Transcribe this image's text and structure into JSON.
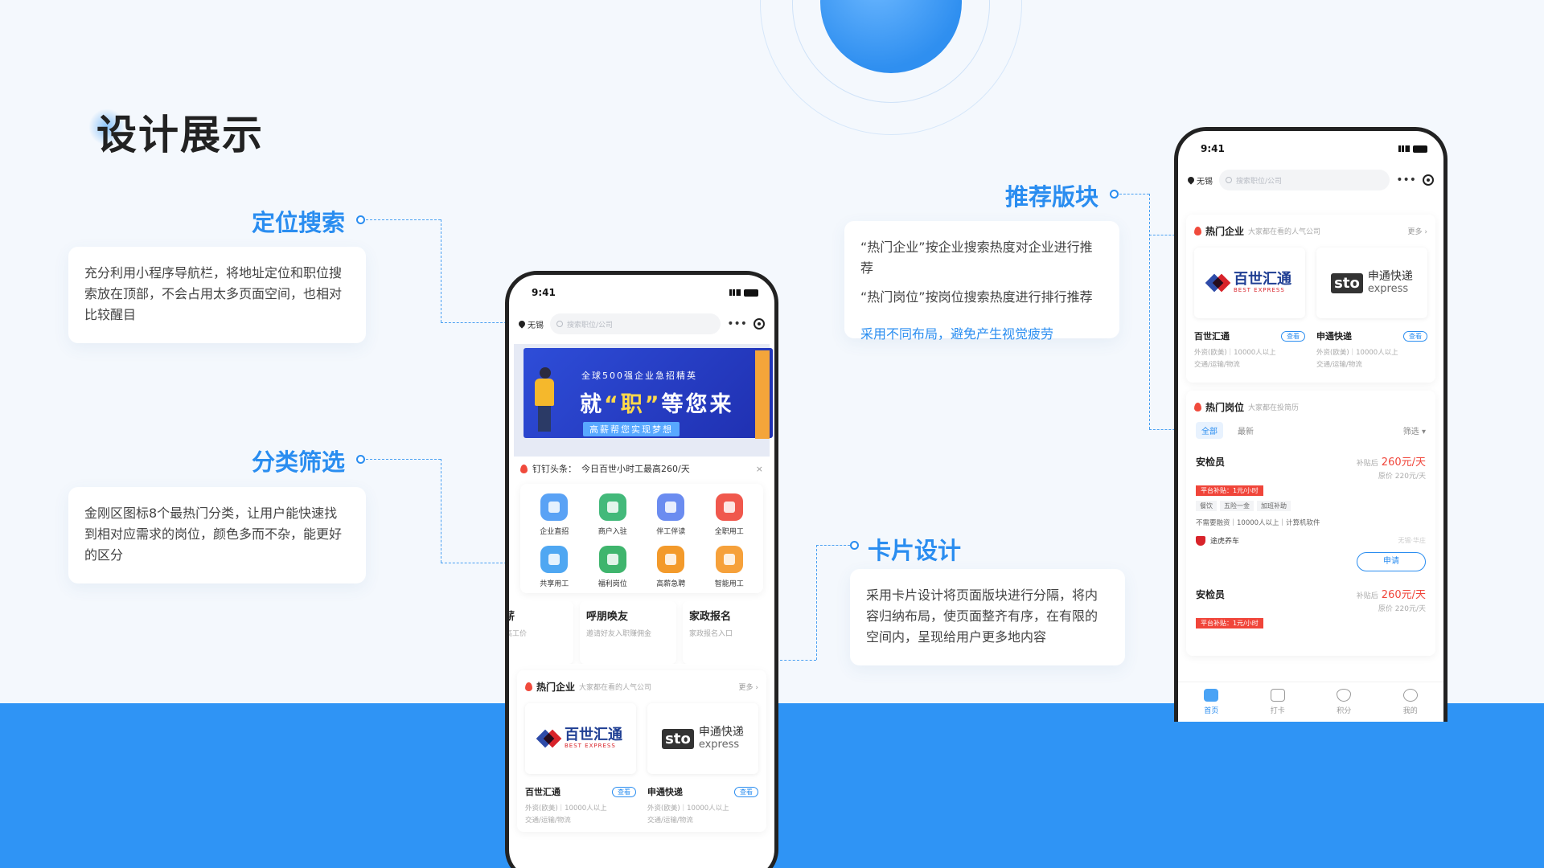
{
  "page": {
    "title": "设计展示"
  },
  "accent_color": "#2a8df0",
  "band_color": "#2f94f5",
  "annotations": {
    "location_search": {
      "label": "定位搜索",
      "desc": "充分利用小程序导航栏，将地址定位和职位搜索放在顶部，不会占用太多页面空间，也相对比较醒目"
    },
    "category_filter": {
      "label": "分类筛选",
      "desc": "金刚区图标8个最热门分类，让用户能快速找到相对应需求的岗位，颜色多而不杂，能更好的区分"
    },
    "recommend": {
      "label": "推荐版块",
      "line1": "“热门企业”按企业搜索热度对企业进行推荐",
      "line2": "“热门岗位”按岗位搜索热度进行排行推荐",
      "line3": "采用不同布局，避免产生视觉疲劳"
    },
    "card_design": {
      "label": "卡片设计",
      "desc": "采用卡片设计将页面版块进行分隔，将内容归纳布局，使页面整齐有序，在有限的空间内，呈现给用户更多地内容"
    }
  },
  "phone": {
    "time": "9:41",
    "location": "无锡",
    "search_placeholder": "搜索职位/公司",
    "menu_icon": "more-dots-icon",
    "banner": {
      "sub": "全球500强企业急招精英",
      "main_a": "就",
      "main_b": "“职”",
      "main_c": "等您来",
      "tag": "高薪帮您实现梦想"
    },
    "notice": {
      "prefix": "钉钉头条：",
      "text": "今日百世小时工最高260/天",
      "close": "×"
    },
    "categories": [
      {
        "label": "企业直招",
        "color": "#5aa2f5"
      },
      {
        "label": "商户入驻",
        "color": "#43b97a"
      },
      {
        "label": "伴工伴读",
        "color": "#6b8cf0"
      },
      {
        "label": "全职用工",
        "color": "#f0584d"
      },
      {
        "label": "共享用工",
        "color": "#4fa7f2"
      },
      {
        "label": "福利岗位",
        "color": "#3fb56d"
      },
      {
        "label": "高薪急聘",
        "color": "#f39a2b"
      },
      {
        "label": "智能用工",
        "color": "#f6a13b"
      }
    ],
    "promos": [
      {
        "title": "工赚薪",
        "sub": "成功拿高工价"
      },
      {
        "title": "呼朋唤友",
        "sub": "邀请好友入职赚佣金"
      },
      {
        "title": "家政报名",
        "sub": "家政报名入口"
      }
    ],
    "hot_companies": {
      "title": "热门企业",
      "hint": "大家都在看的人气公司",
      "more": "更多 ›",
      "items": [
        {
          "logo_text": "百世汇通",
          "logo_en": "BEST EXPRESS",
          "name": "百世汇通",
          "chip": "查看",
          "meta1": "外资(欧美)｜10000人以上",
          "meta2": "交通/运输/物流"
        },
        {
          "logo_mark": "sto",
          "logo_text": "申通快递",
          "logo_en": "express",
          "name": "申通快递",
          "chip": "查看",
          "meta1": "外资(欧美)｜10000人以上",
          "meta2": "交通/运输/物流"
        }
      ]
    },
    "hot_jobs": {
      "title": "热门岗位",
      "hint": "大家都在投简历",
      "tab_all": "全部",
      "tab_new": "最新",
      "filter": "筛选 ▾",
      "items": [
        {
          "title": "安检员",
          "pay_label": "补贴后",
          "pay": "260元/天",
          "orig": "原价 220元/天",
          "tag": "平台补贴：1元/小时",
          "tags": [
            "餐饮",
            "五险一金",
            "加班补助"
          ],
          "meta": "不需要融资｜10000人以上｜计算机软件",
          "company": "途虎养车",
          "dist": "无锡·华庄",
          "apply": "申请"
        },
        {
          "title": "安检员",
          "pay_label": "补贴后",
          "pay": "260元/天",
          "orig": "原价 220元/天",
          "tag": "平台补贴：1元/小时"
        }
      ]
    },
    "tabbar": [
      {
        "label": "首页",
        "icon": "home-icon"
      },
      {
        "label": "打卡",
        "icon": "checkin-icon"
      },
      {
        "label": "积分",
        "icon": "points-icon"
      },
      {
        "label": "我的",
        "icon": "profile-icon"
      }
    ]
  }
}
